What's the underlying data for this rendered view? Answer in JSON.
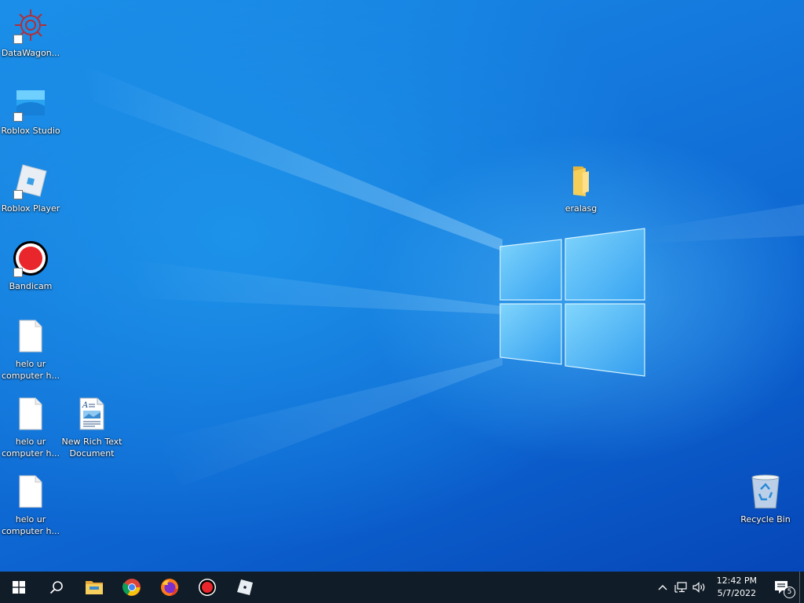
{
  "desktop": {
    "icons": [
      {
        "label": "DataWagon...",
        "icon": "datawagon-icon",
        "shortcut": true
      },
      {
        "label": "Roblox Studio",
        "icon": "roblox-studio-icon",
        "shortcut": true
      },
      {
        "label": "Roblox Player",
        "icon": "roblox-player-icon",
        "shortcut": true
      },
      {
        "label": "Bandicam",
        "icon": "bandicam-icon",
        "shortcut": true
      },
      {
        "label": "helo ur computer h...",
        "icon": "text-file-icon",
        "shortcut": false
      },
      {
        "label": "helo ur computer h...",
        "icon": "text-file-icon",
        "shortcut": false
      },
      {
        "label": "helo ur computer h...",
        "icon": "text-file-icon",
        "shortcut": false
      },
      {
        "label": "New Rich Text Document",
        "icon": "rich-text-document-icon",
        "shortcut": false
      },
      {
        "label": "eralasg",
        "icon": "folder-icon",
        "shortcut": false
      },
      {
        "label": "Recycle Bin",
        "icon": "recycle-bin-icon",
        "shortcut": false
      }
    ],
    "wallpaper_colors": {
      "light": "#5ac8ff",
      "mid": "#1478dc",
      "dark": "#0646b8"
    }
  },
  "taskbar": {
    "background": "#101c28",
    "buttons": [
      {
        "icon": "windows-start-icon"
      },
      {
        "icon": "search-icon"
      },
      {
        "icon": "file-explorer-icon"
      },
      {
        "icon": "chrome-icon"
      },
      {
        "icon": "firefox-icon"
      },
      {
        "icon": "bandicam-icon"
      },
      {
        "icon": "roblox-icon"
      }
    ],
    "tray": {
      "time": "12:42 PM",
      "date": "5/7/2022",
      "notification_count": "5"
    }
  }
}
